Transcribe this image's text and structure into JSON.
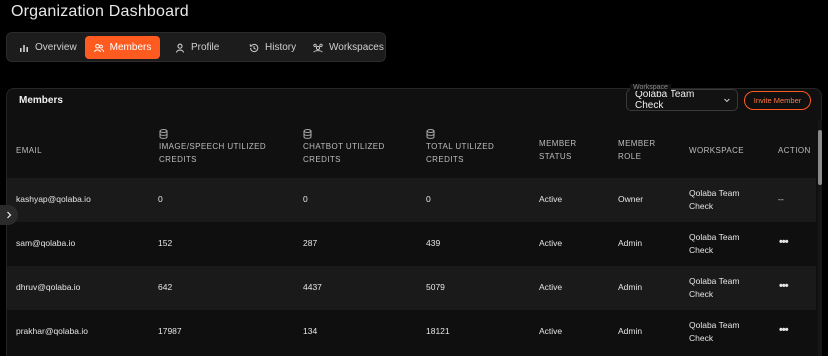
{
  "page": {
    "title": "Organization Dashboard"
  },
  "tabs": [
    {
      "label": "Overview",
      "icon": "bar-chart-icon",
      "active": false
    },
    {
      "label": "Members",
      "icon": "users-icon",
      "active": true
    },
    {
      "label": "Profile",
      "icon": "user-icon",
      "active": false
    },
    {
      "label": "History",
      "icon": "history-icon",
      "active": false
    },
    {
      "label": "Workspaces",
      "icon": "workspaces-icon",
      "active": false
    }
  ],
  "members": {
    "title": "Members",
    "workspace_label": "Workspace",
    "workspace_value": "Qolaba Team Check",
    "invite_label": "Invite Member",
    "columns": {
      "email": "EMAIL",
      "image_credits": "IMAGE/SPEECH UTILIZED CREDITS",
      "chatbot_credits": "CHATBOT UTILIZED CREDITS",
      "total_credits": "TOTAL UTILIZED CREDITS",
      "status": "MEMBER STATUS",
      "role": "MEMBER ROLE",
      "workspace": "WORKSPACE",
      "action": "ACTION"
    },
    "rows": [
      {
        "email": "kashyap@qolaba.io",
        "image": "0",
        "chatbot": "0",
        "total": "0",
        "status": "Active",
        "role": "Owner",
        "workspace": "Qolaba Team Check",
        "action": "--"
      },
      {
        "email": "sam@qolaba.io",
        "image": "152",
        "chatbot": "287",
        "total": "439",
        "status": "Active",
        "role": "Admin",
        "workspace": "Qolaba Team Check",
        "action": "•••"
      },
      {
        "email": "dhruv@qolaba.io",
        "image": "642",
        "chatbot": "4437",
        "total": "5079",
        "status": "Active",
        "role": "Admin",
        "workspace": "Qolaba Team Check",
        "action": "•••"
      },
      {
        "email": "prakhar@qolaba.io",
        "image": "17987",
        "chatbot": "134",
        "total": "18121",
        "status": "Active",
        "role": "Admin",
        "workspace": "Qolaba Team Check",
        "action": "•••"
      }
    ]
  },
  "colors": {
    "accent": "#ff5a1f",
    "background": "#000000",
    "panel": "#101010"
  }
}
